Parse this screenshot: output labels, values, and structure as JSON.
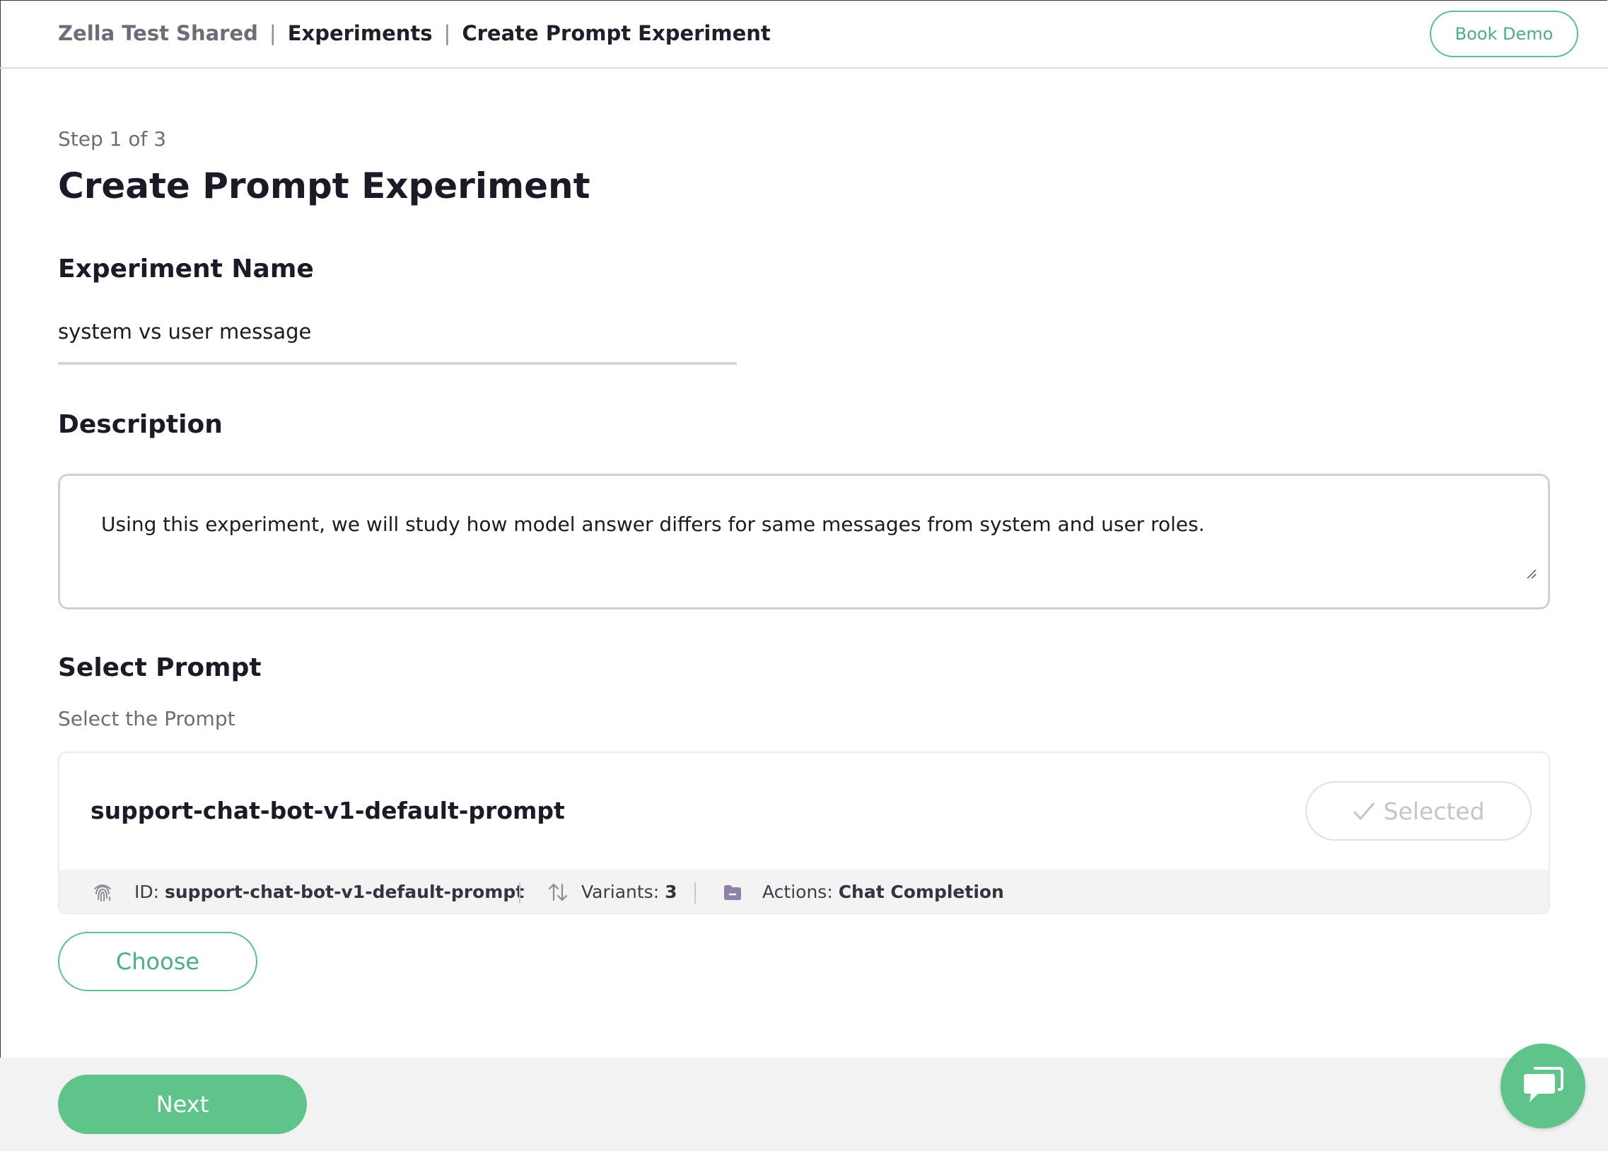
{
  "breadcrumb": {
    "items": [
      "Zella Test Shared",
      "Experiments",
      "Create Prompt Experiment"
    ],
    "separator": "|"
  },
  "header": {
    "book_demo_label": "Book Demo"
  },
  "page": {
    "step": "Step 1 of 3",
    "title": "Create Prompt Experiment"
  },
  "experiment_name": {
    "label": "Experiment Name",
    "value": "system vs user message"
  },
  "description": {
    "label": "Description",
    "value": "Using this experiment, we will study how model answer differs for same messages from system and user roles."
  },
  "select_prompt": {
    "label": "Select Prompt",
    "sublabel": "Select the Prompt",
    "card": {
      "name": "support-chat-bot-v1-default-prompt",
      "selected_label": "Selected",
      "id_label": "ID:",
      "id_value": "support-chat-bot-v1-default-prompt",
      "variants_label": "Variants:",
      "variants_value": "3",
      "actions_label": "Actions:",
      "actions_value": "Chat Completion"
    },
    "choose_label": "Choose"
  },
  "footer": {
    "next_label": "Next"
  },
  "colors": {
    "accent": "#5ec48a",
    "accent_text": "#4caf7d",
    "muted_text": "#6b6d78",
    "heading_text": "#1a1b27",
    "footer_bg": "#f2f2f2"
  },
  "icons": {
    "id": "fingerprint-icon",
    "variants": "sort-arrows-icon",
    "actions": "folder-icon",
    "selected": "check-icon",
    "chat": "chat-bubble-icon"
  }
}
